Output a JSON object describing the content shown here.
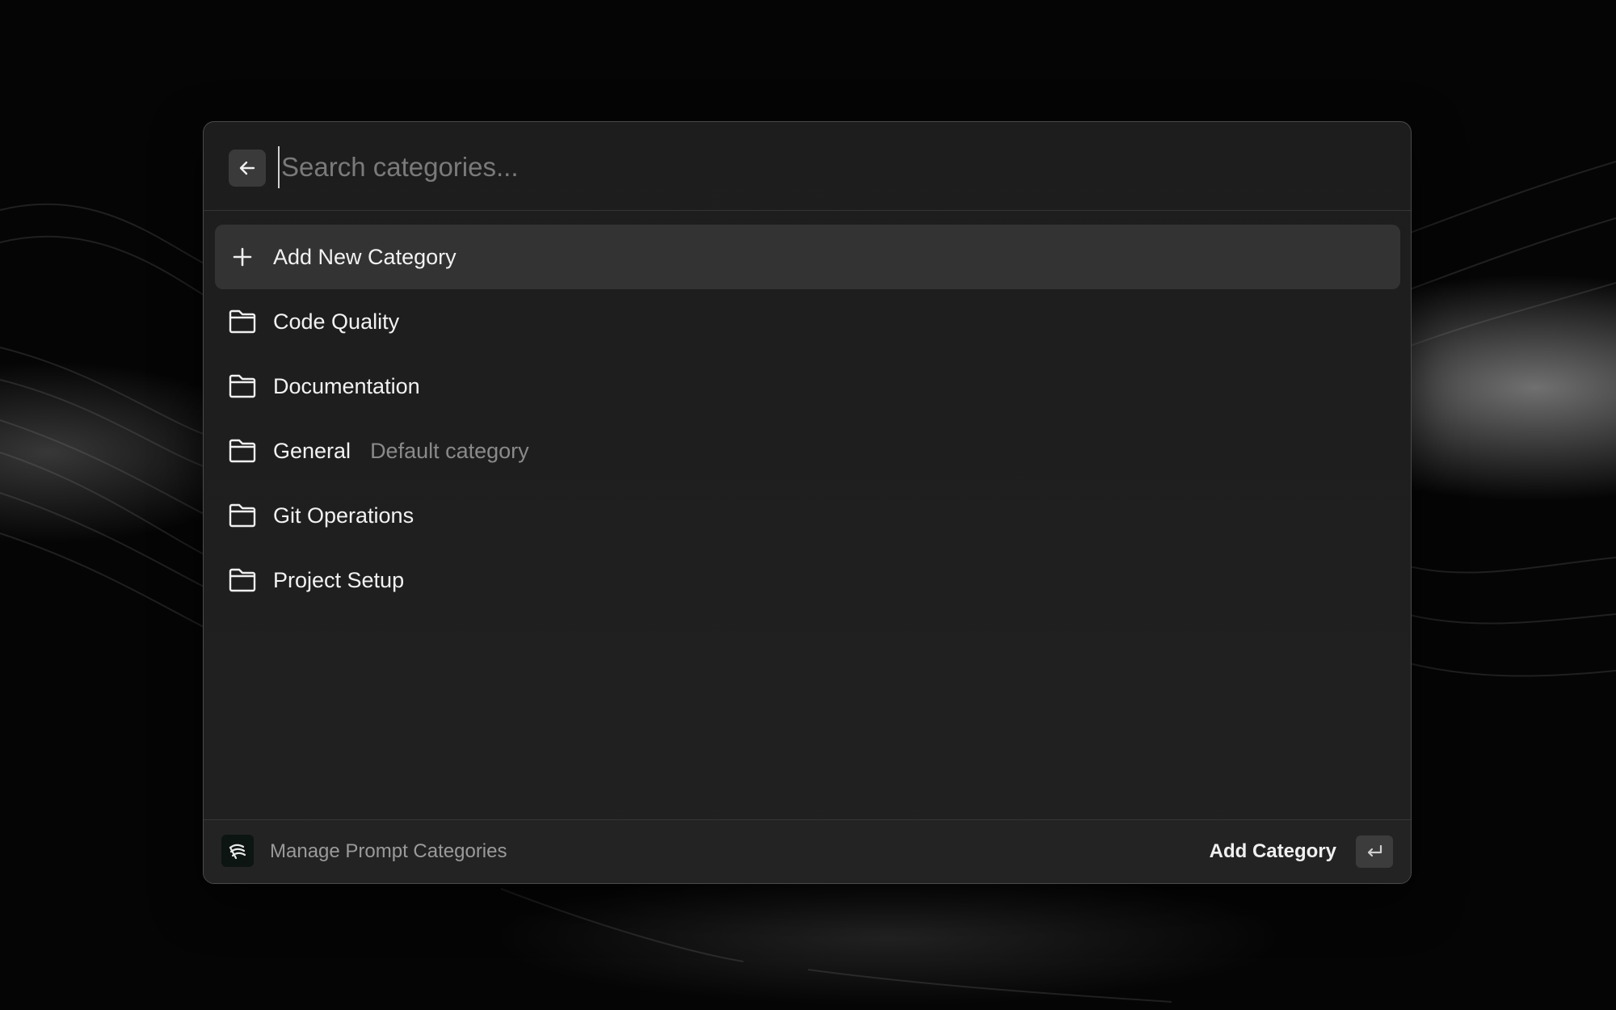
{
  "search": {
    "placeholder": "Search categories...",
    "value": ""
  },
  "list": {
    "items": [
      {
        "label": "Add New Category",
        "subtitle": "",
        "icon": "plus-icon",
        "selected": true
      },
      {
        "label": "Code Quality",
        "subtitle": "",
        "icon": "folder-icon",
        "selected": false
      },
      {
        "label": "Documentation",
        "subtitle": "",
        "icon": "folder-icon",
        "selected": false
      },
      {
        "label": "General",
        "subtitle": "Default category",
        "icon": "folder-icon",
        "selected": false
      },
      {
        "label": "Git Operations",
        "subtitle": "",
        "icon": "folder-icon",
        "selected": false
      },
      {
        "label": "Project Setup",
        "subtitle": "",
        "icon": "folder-icon",
        "selected": false
      }
    ]
  },
  "footer": {
    "title": "Manage Prompt Categories",
    "action_label": "Add Category",
    "action_key_icon": "enter-key-icon",
    "logo_icon": "app-logo-icon"
  },
  "icons": {
    "back": "arrow-left-icon"
  },
  "colors": {
    "window_bg": "#1e1e1e",
    "selected_row_bg": "#333333",
    "text_primary": "#f2f2f2",
    "text_secondary": "#8a8a8a",
    "placeholder": "#7a7a7a"
  }
}
